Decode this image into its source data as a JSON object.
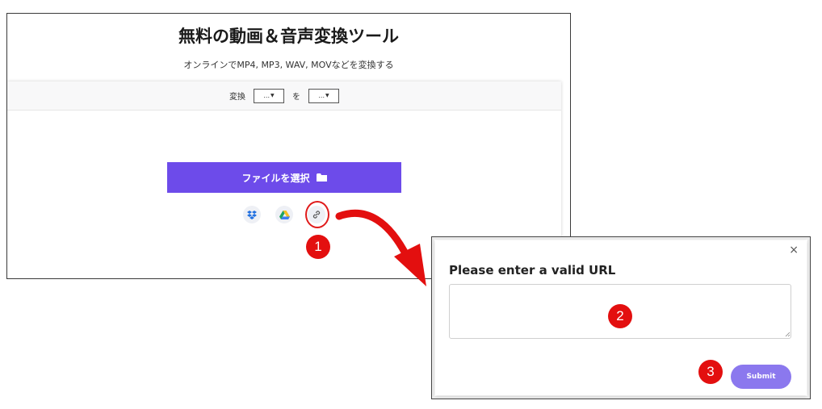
{
  "page": {
    "title": "無料の動画＆音声変換ツール",
    "subtitle": "オンラインでMP4, MP3, WAV, MOVなどを変換する"
  },
  "converter": {
    "convert_label": "変換",
    "from_value": "...",
    "to_label": "を",
    "to_value": "..."
  },
  "upload": {
    "choose_file_label": "ファイルを選択",
    "sources": [
      "dropbox-icon",
      "google-drive-icon",
      "link-icon"
    ]
  },
  "dialog": {
    "title": "Please enter a valid URL",
    "input_value": "",
    "submit_label": "Submit",
    "close_label": "×"
  },
  "annotations": {
    "step1": "1",
    "step2": "2",
    "step3": "3"
  },
  "colors": {
    "primary": "#6d4bea",
    "submit": "#8b78ee",
    "annotation_red": "#e30f0f"
  }
}
